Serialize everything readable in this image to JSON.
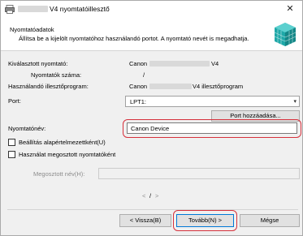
{
  "window": {
    "title": "V4 nyomtatóillesztő",
    "close_symbol": "✕"
  },
  "header": {
    "title": "Nyomtatóadatok",
    "description": "Állítsa be a kijelölt nyomtatóhoz használandó portot. A nyomtató nevét is megadhatja.",
    "logo_icon": "canon-cube-icon"
  },
  "info": {
    "selected_printer_label": "Kiválasztott nyomtató:",
    "selected_printer_prefix": "Canon",
    "selected_printer_suffix": "V4",
    "printer_count_label": "Nyomtatók száma:",
    "printer_count_value": "/",
    "driver_label": "Használandó illesztőprogram:",
    "driver_prefix": "Canon",
    "driver_suffix": "V4 illesztőprogram"
  },
  "port": {
    "label": "Port:",
    "selected": "LPT1:",
    "add_button": "Port hozzáadása..."
  },
  "printer_name": {
    "label": "Nyomtatónév:",
    "value": "Canon Device"
  },
  "options": {
    "set_default_label": "Beállítás alapértelmezettként(U)",
    "set_default_checked": false,
    "shared_label": "Használat megosztott nyomtatóként",
    "shared_checked": false,
    "share_name_label": "Megosztott név(H):",
    "share_name_value": ""
  },
  "pager": {
    "prev": "<",
    "text": "/",
    "next": ">"
  },
  "buttons": {
    "back": "< Vissza(B)",
    "next": "Tovább(N) >",
    "cancel": "Mégse"
  },
  "colors": {
    "highlight_ring": "#d6313c",
    "primary_border": "#0078d7",
    "logo_teal": "#1fa8a8"
  }
}
